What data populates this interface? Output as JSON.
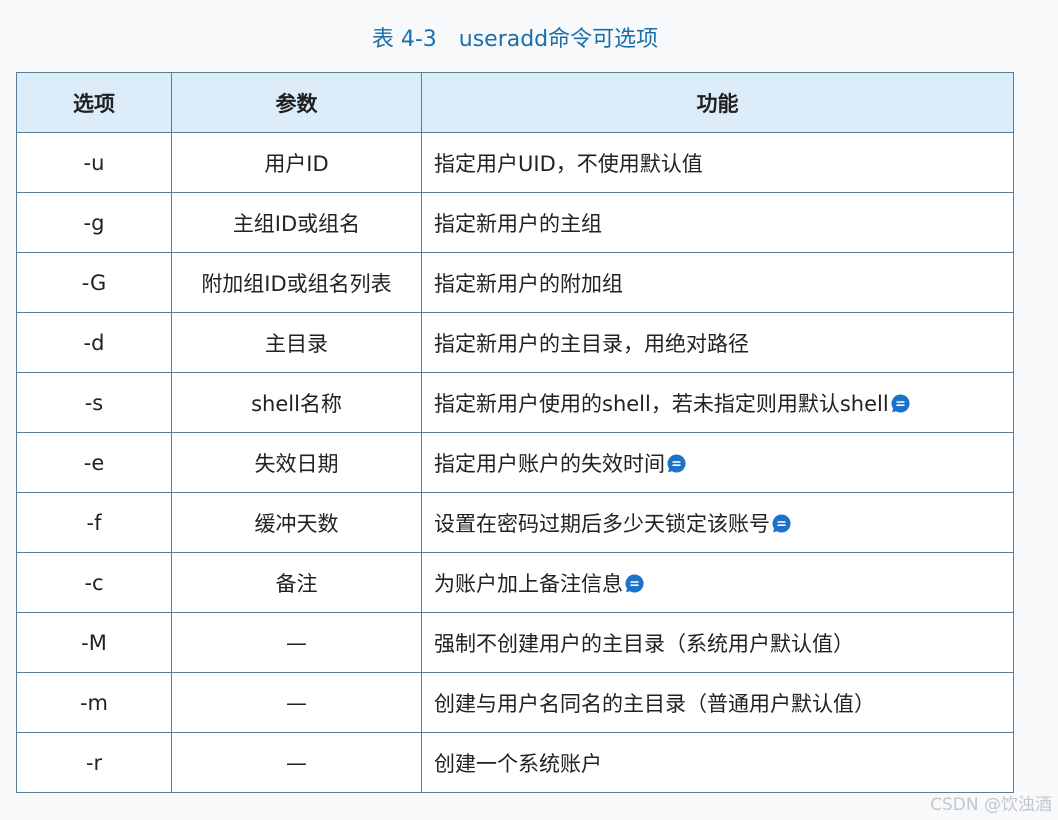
{
  "caption": "表 4-3　useradd命令可选项",
  "headers": [
    "选项",
    "参数",
    "功能"
  ],
  "rows": [
    {
      "option": "-u",
      "param": "用户ID",
      "function": "指定用户UID，不使用默认值",
      "comment": false
    },
    {
      "option": "-g",
      "param": "主组ID或组名",
      "function": "指定新用户的主组",
      "comment": false
    },
    {
      "option": "-G",
      "param": "附加组ID或组名列表",
      "function": "指定新用户的附加组",
      "comment": false
    },
    {
      "option": "-d",
      "param": "主目录",
      "function": "指定新用户的主目录，用绝对路径",
      "comment": false
    },
    {
      "option": "-s",
      "param": "shell名称",
      "function": "指定新用户使用的shell，若未指定则用默认shell",
      "comment": true
    },
    {
      "option": "-e",
      "param": "失效日期",
      "function": "指定用户账户的失效时间",
      "comment": true
    },
    {
      "option": "-f",
      "param": "缓冲天数",
      "function": "设置在密码过期后多少天锁定该账号",
      "comment": true
    },
    {
      "option": "-c",
      "param": "备注",
      "function": "为账户加上备注信息",
      "comment": true
    },
    {
      "option": "-M",
      "param": "—",
      "function": "强制不创建用户的主目录（系统用户默认值）",
      "comment": false
    },
    {
      "option": "-m",
      "param": "—",
      "function": "创建与用户名同名的主目录（普通用户默认值）",
      "comment": false
    },
    {
      "option": "-r",
      "param": "—",
      "function": "创建一个系统账户",
      "comment": false
    }
  ],
  "comment_icon": "comment-bubble-icon",
  "comment_icon_color": "#1a73c9",
  "watermark": "CSDN @饮浊酒"
}
